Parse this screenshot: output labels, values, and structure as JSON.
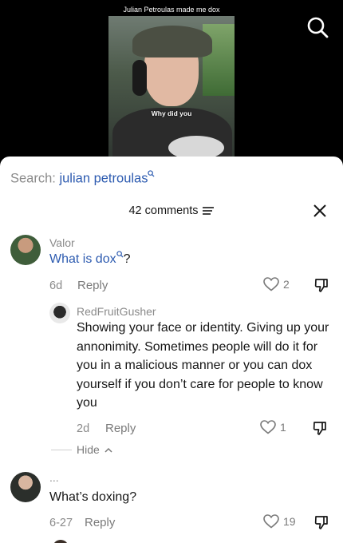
{
  "video": {
    "caption": "Julian Petroulas made me dox",
    "subtitle": "Why did you"
  },
  "sheet": {
    "search_label": "Search:",
    "search_query": "julian petroulas",
    "comment_count": "42 comments"
  },
  "comments": [
    {
      "username": "Valor",
      "text_link": "What is dox",
      "text_after": "?",
      "age": "6d",
      "reply_label": "Reply",
      "likes": "2"
    },
    {
      "username": "RedFruitGusher",
      "text": "Showing your face or identity. Giving up your annonimity. Sometimes people will do it for you in a malicious manner or you can dox yourself if you don’t care for people to know you",
      "age": "2d",
      "reply_label": "Reply",
      "likes": "1",
      "hide_label": "Hide"
    },
    {
      "username": "...",
      "text": "What’s doxing?",
      "age": "6-27",
      "reply_label": "Reply",
      "likes": "19"
    }
  ],
  "colors": {
    "link": "#2d5bb0",
    "muted": "#8a8a8a",
    "text": "#161616"
  }
}
